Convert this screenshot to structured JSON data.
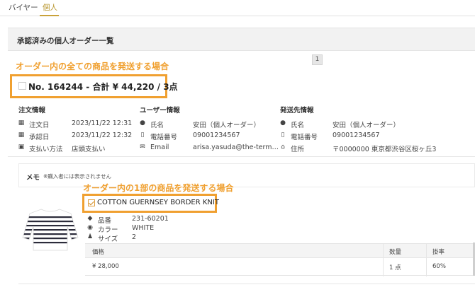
{
  "tabs": [
    {
      "label": "バイヤー"
    },
    {
      "label": "個人"
    }
  ],
  "section_title": "承認済みの個人オーダー一覧",
  "pagination": {
    "current": "1"
  },
  "annotations": {
    "all_items": "オーダー内の全ての商品を発送する場合",
    "partial_items": "オーダー内の1部の商品を発送する場合"
  },
  "order": {
    "title": "No. 164244 - 合計 ¥ 44,220 / 3点"
  },
  "order_info": {
    "heading": "注文情報",
    "rows": [
      {
        "icon": "calendar-icon",
        "label": "注文日",
        "value": "2023/11/22 12:31"
      },
      {
        "icon": "calendar-icon",
        "label": "承認日",
        "value": "2023/11/22 12:32"
      },
      {
        "icon": "money-icon",
        "label": "支払い方法",
        "value": "店頭支払い"
      }
    ]
  },
  "user_info": {
    "heading": "ユーザー情報",
    "rows": [
      {
        "icon": "person-icon",
        "label": "氏名",
        "value": "安田（個人オーダー）"
      },
      {
        "icon": "phone-icon",
        "label": "電話番号",
        "value": "09001234567"
      },
      {
        "icon": "envelope-icon",
        "label": "Email",
        "value": "arisa.yasuda@the-term…"
      }
    ]
  },
  "shipping_info": {
    "heading": "発送先情報",
    "rows": [
      {
        "icon": "person-icon",
        "label": "氏名",
        "value": "安田（個人オーダー）"
      },
      {
        "icon": "phone-icon",
        "label": "電話番号",
        "value": "09001234567"
      },
      {
        "icon": "home-icon",
        "label": "住所",
        "value": "〒0000000 東京都渋谷区桜ヶ丘3"
      }
    ]
  },
  "memo": {
    "label": "メモ",
    "note": "※購入者には表示されません"
  },
  "item": {
    "name": "COTTON GUERNSEY BORDER KNIT",
    "checked": true,
    "attributes": [
      {
        "icon": "tag-icon",
        "label": "品番",
        "value": "231-60201"
      },
      {
        "icon": "palette-icon",
        "label": "カラー",
        "value": "WHITE"
      },
      {
        "icon": "figure-icon",
        "label": "サイズ",
        "value": "2"
      }
    ],
    "table": {
      "headers": [
        "価格",
        "数量",
        "掛率"
      ],
      "values": [
        "¥ 28,000",
        "1 点",
        "60%"
      ]
    }
  },
  "colors": {
    "accent": "#c9a23a",
    "annotation": "#f0a030"
  }
}
